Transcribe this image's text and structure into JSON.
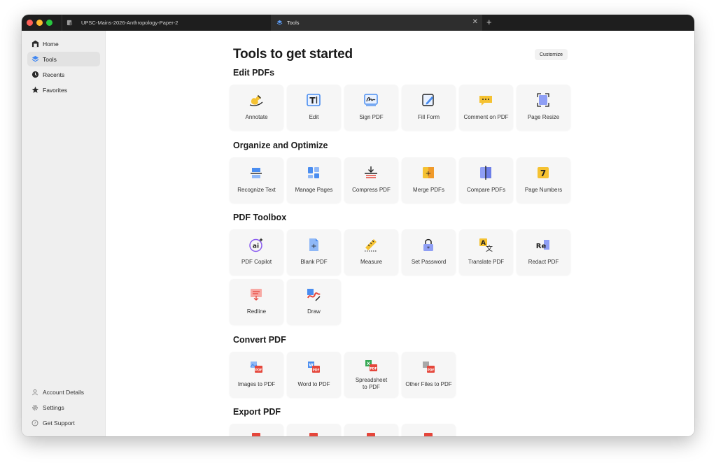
{
  "tabs": [
    {
      "title": "UPSC-Mains-2026-Anthropology-Paper-2"
    },
    {
      "title": "Tools"
    }
  ],
  "sidebar": {
    "top": [
      {
        "label": "Home",
        "icon": "home-icon"
      },
      {
        "label": "Tools",
        "icon": "tools-layers-icon"
      },
      {
        "label": "Recents",
        "icon": "clock-icon"
      },
      {
        "label": "Favorites",
        "icon": "star-icon"
      }
    ],
    "bottom": [
      {
        "label": "Account Details",
        "icon": "person-icon"
      },
      {
        "label": "Settings",
        "icon": "gear-icon"
      },
      {
        "label": "Get Support",
        "icon": "help-icon"
      }
    ]
  },
  "page": {
    "title": "Tools to get started",
    "customize_label": "Customize"
  },
  "sections": [
    {
      "title": "Edit PDFs",
      "tools": [
        {
          "label": "Annotate",
          "icon": "highlighter-icon"
        },
        {
          "label": "Edit",
          "icon": "text-edit-icon"
        },
        {
          "label": "Sign PDF",
          "icon": "signature-icon"
        },
        {
          "label": "Fill Form",
          "icon": "form-pencil-icon"
        },
        {
          "label": "Comment on PDF",
          "icon": "comment-icon"
        },
        {
          "label": "Page Resize",
          "icon": "resize-icon"
        }
      ]
    },
    {
      "title": "Organize and Optimize",
      "tools": [
        {
          "label": "Recognize Text",
          "icon": "ocr-icon"
        },
        {
          "label": "Manage Pages",
          "icon": "pages-grid-icon"
        },
        {
          "label": "Compress PDF",
          "icon": "compress-icon"
        },
        {
          "label": "Merge PDFs",
          "icon": "merge-icon"
        },
        {
          "label": "Compare PDFs",
          "icon": "compare-icon"
        },
        {
          "label": "Page Numbers",
          "icon": "page-number-icon"
        }
      ]
    },
    {
      "title": "PDF Toolbox",
      "tools": [
        {
          "label": "PDF Copilot",
          "icon": "ai-icon"
        },
        {
          "label": "Blank PDF",
          "icon": "blank-page-icon"
        },
        {
          "label": "Measure",
          "icon": "ruler-icon"
        },
        {
          "label": "Set Password",
          "icon": "lock-icon"
        },
        {
          "label": "Translate PDF",
          "icon": "translate-icon"
        },
        {
          "label": "Redact PDF",
          "icon": "redact-icon"
        },
        {
          "label": "Redline",
          "icon": "redline-icon"
        },
        {
          "label": "Draw",
          "icon": "draw-icon"
        }
      ]
    },
    {
      "title": "Convert PDF",
      "tools": [
        {
          "label": "Images to PDF",
          "icon": "image-to-pdf-icon"
        },
        {
          "label": "Word to PDF",
          "icon": "word-to-pdf-icon"
        },
        {
          "label": "Spreadsheet to PDF",
          "icon": "spreadsheet-to-pdf-icon"
        },
        {
          "label": "Other Files to PDF",
          "icon": "file-to-pdf-icon"
        }
      ]
    },
    {
      "title": "Export PDF",
      "tools": []
    }
  ],
  "colors": {
    "titlebar": "#1e1e1e",
    "sidebar_bg": "#efefef",
    "tile_bg": "#f6f6f6",
    "accent_blue": "#4a8df0",
    "pdf_red": "#e5463b",
    "accent_yellow": "#f5c232"
  }
}
